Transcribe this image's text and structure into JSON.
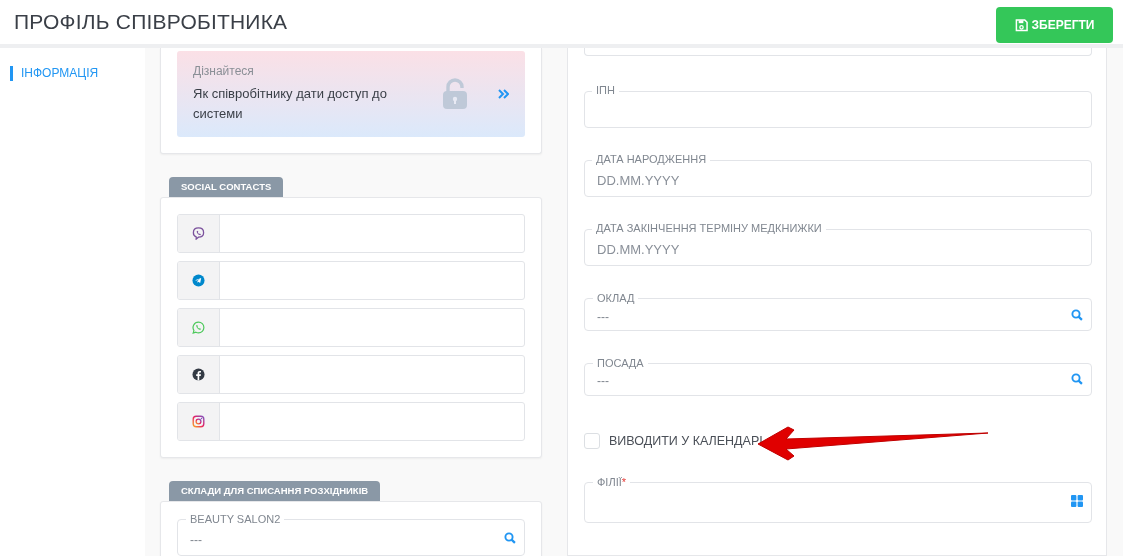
{
  "page_title": "ПРОФІЛЬ СПІВРОБІТНИКА",
  "save_button": {
    "label": "ЗБЕРЕГТИ"
  },
  "sidebar": {
    "items": [
      {
        "label": "ІНФОРМАЦІЯ",
        "selected": true
      }
    ]
  },
  "info_card": {
    "caption": "Дізнайтеся",
    "text": "Як співробітнику дати доступ до системи"
  },
  "social_contacts": {
    "title": "SOCIAL CONTACTS",
    "fields": [
      {
        "kind": "viber"
      },
      {
        "kind": "telegram"
      },
      {
        "kind": "whatsapp"
      },
      {
        "kind": "facebook"
      },
      {
        "kind": "instagram"
      }
    ]
  },
  "warehouses": {
    "title": "СКЛАДИ ДЛЯ СПИСАННЯ РОЗХІДНИКІВ",
    "fields": [
      {
        "label": "BEAUTY SALON2",
        "value": "---"
      }
    ]
  },
  "form": {
    "fields": [
      {
        "kind": "stub"
      },
      {
        "kind": "text",
        "label": "ІПН"
      },
      {
        "kind": "date",
        "label": "ДАТА НАРОДЖЕННЯ",
        "placeholder": "DD.MM.YYYY"
      },
      {
        "kind": "date",
        "label": "ДАТА ЗАКІНЧЕННЯ ТЕРМІНУ МЕДКНИЖКИ",
        "placeholder": "DD.MM.YYYY"
      },
      {
        "kind": "lookup",
        "label": "ОКЛАД",
        "value": "---"
      },
      {
        "kind": "lookup",
        "label": "ПОСАДА",
        "value": "---"
      },
      {
        "kind": "checkbox",
        "label": "ВИВОДИТИ У КАЛЕНДАРІ",
        "checked": false
      },
      {
        "kind": "multi",
        "label": "ФІЛІЇ",
        "required_mark": "*"
      }
    ]
  }
}
